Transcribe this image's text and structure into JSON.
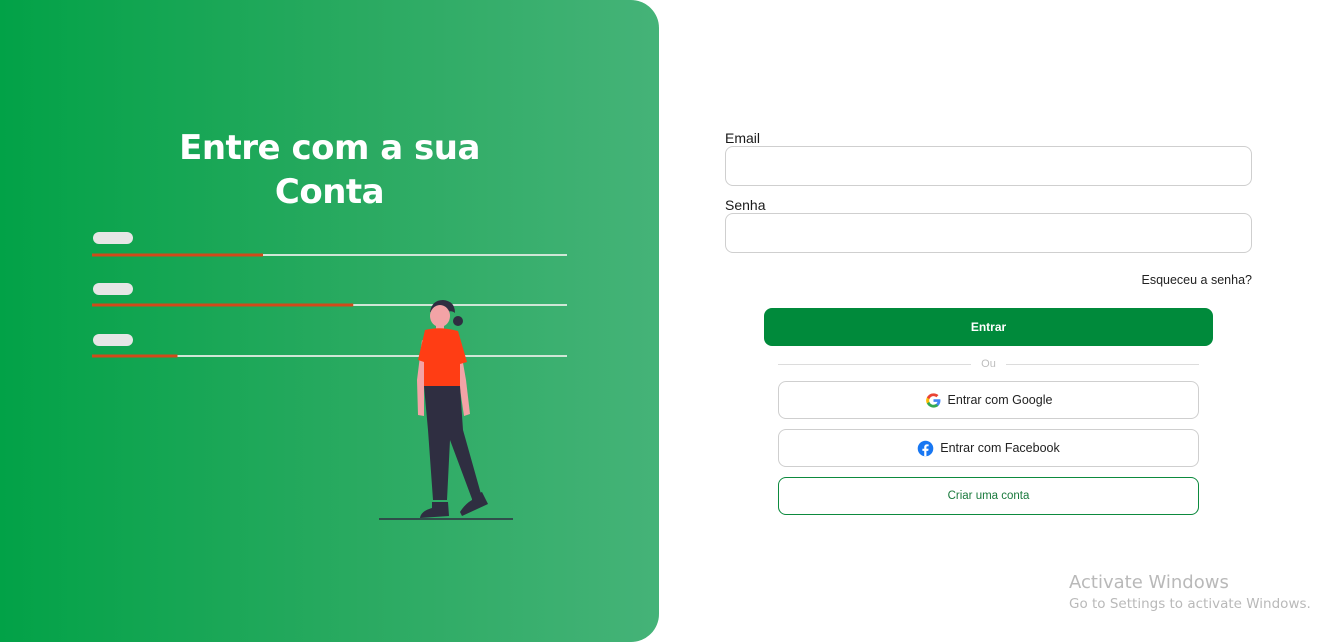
{
  "hero": {
    "title_line1": "Entre com a sua",
    "title_line2": "Conta"
  },
  "colors": {
    "brand_green": "#008a3b",
    "panel_gradient_start": "#02a247",
    "panel_gradient_end": "#45b378",
    "progress_accent": "#d14a1a",
    "person_shirt": "#ff3d14",
    "person_pants": "#2f2e41"
  },
  "illustration": {
    "progress_rows": [
      {
        "fraction": 0.36
      },
      {
        "fraction": 0.55
      },
      {
        "fraction": 0.18
      }
    ]
  },
  "form": {
    "email_label": "Email",
    "email_value": "",
    "password_label": "Senha",
    "password_value": "",
    "forgot_link": "Esqueceu a senha?",
    "login_button": "Entrar",
    "divider_text": "Ou",
    "google_button": "Entrar com Google",
    "google_icon": "google-icon",
    "facebook_button": "Entrar com Facebook",
    "facebook_icon": "facebook-icon",
    "create_account_button": "Criar uma conta"
  },
  "watermark": {
    "title": "Activate Windows",
    "subtitle": "Go to Settings to activate Windows."
  }
}
